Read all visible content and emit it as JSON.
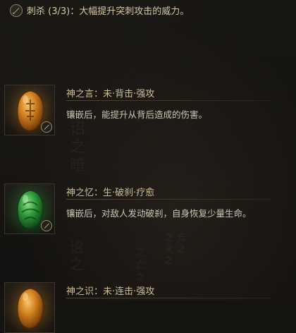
{
  "header": {
    "icon": "dagger-icon",
    "text": "刺杀 (3/3)：大幅提升突刺攻击的威力。"
  },
  "entries": [
    {
      "gem": "amber-gem",
      "gem_color": "#c9781c",
      "title": "神之言：未·背击·强攻",
      "description": "镶嵌后，能提升从背后造成的伤害。"
    },
    {
      "gem": "jade-gem",
      "gem_color": "#2f9a3a",
      "title": "神之忆：生·破刹·疗愈",
      "description": "镶嵌后，对敌人发动破刹，自身恢复少量生命。"
    },
    {
      "gem": "amber-gem",
      "gem_color": "#c9781c",
      "title": "神之识：未·连击·强攻",
      "description": ""
    }
  ],
  "background_calligraphy": {
    "col1": "诏之暗",
    "col2": "诏之",
    "col3": "之义之",
    "col4": "光之",
    "col5": "之亡之"
  }
}
